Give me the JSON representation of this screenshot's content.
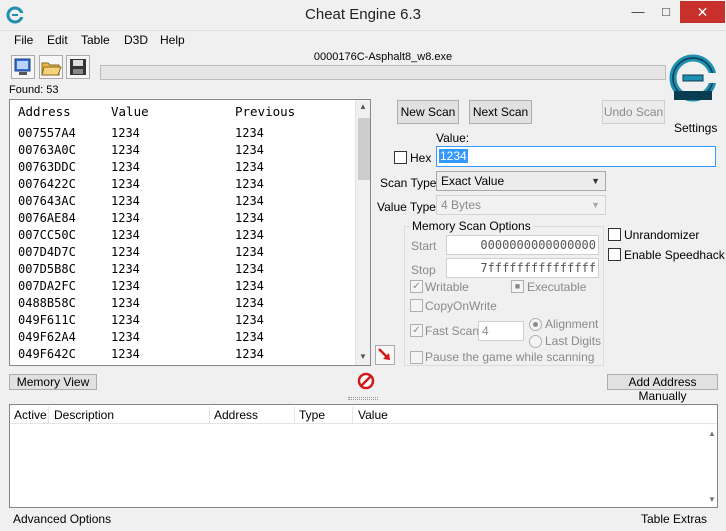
{
  "window": {
    "title": "Cheat Engine 6.3"
  },
  "menu": [
    "File",
    "Edit",
    "Table",
    "D3D",
    "Help"
  ],
  "process": {
    "name": "0000176C-Asphalt8_w8.exe",
    "progress": 0
  },
  "found_label": "Found: 53",
  "results": {
    "columns": [
      "Address",
      "Value",
      "Previous"
    ],
    "rows": [
      {
        "address": "007557A4",
        "value": "1234",
        "previous": "1234"
      },
      {
        "address": "00763A0C",
        "value": "1234",
        "previous": "1234"
      },
      {
        "address": "00763DDC",
        "value": "1234",
        "previous": "1234"
      },
      {
        "address": "0076422C",
        "value": "1234",
        "previous": "1234"
      },
      {
        "address": "007643AC",
        "value": "1234",
        "previous": "1234"
      },
      {
        "address": "0076AE84",
        "value": "1234",
        "previous": "1234"
      },
      {
        "address": "007CC50C",
        "value": "1234",
        "previous": "1234"
      },
      {
        "address": "007D4D7C",
        "value": "1234",
        "previous": "1234"
      },
      {
        "address": "007D5B8C",
        "value": "1234",
        "previous": "1234"
      },
      {
        "address": "007DA2FC",
        "value": "1234",
        "previous": "1234"
      },
      {
        "address": "0488B58C",
        "value": "1234",
        "previous": "1234"
      },
      {
        "address": "049F611C",
        "value": "1234",
        "previous": "1234"
      },
      {
        "address": "049F62A4",
        "value": "1234",
        "previous": "1234"
      },
      {
        "address": "049F642C",
        "value": "1234",
        "previous": "1234"
      }
    ]
  },
  "scan": {
    "new_scan": "New Scan",
    "next_scan": "Next Scan",
    "undo_scan": "Undo Scan",
    "settings": "Settings",
    "value_label": "Value:",
    "hex_label": "Hex",
    "value": "1234",
    "scan_type_label": "Scan Type",
    "scan_type": "Exact Value",
    "value_type_label": "Value Type",
    "value_type": "4 Bytes"
  },
  "memory_scan": {
    "title": "Memory Scan Options",
    "start_label": "Start",
    "start_value": "0000000000000000",
    "stop_label": "Stop",
    "stop_value": "7fffffffffffffff",
    "writable": "Writable",
    "executable": "Executable",
    "copy_on_write": "CopyOnWrite",
    "fast_scan": "Fast Scan",
    "fast_scan_value": "4",
    "alignment": "Alignment",
    "last_digits": "Last Digits",
    "pause_game": "Pause the game while scanning"
  },
  "options": {
    "unrandomizer": "Unrandomizer",
    "enable_speedhack": "Enable Speedhack"
  },
  "buttons": {
    "memory_view": "Memory View",
    "add_address_manually": "Add Address Manually"
  },
  "address_list": {
    "columns": [
      "Active",
      "Description",
      "Address",
      "Type",
      "Value"
    ]
  },
  "footer": {
    "advanced_options": "Advanced Options",
    "table_extras": "Table Extras"
  },
  "colors": {
    "close_button": "#c7302b",
    "selected_text_bg": "#3399ff",
    "logo_teal": "#1e8fb0"
  },
  "icons": [
    "app-logo-icon",
    "open-process-icon",
    "open-file-icon",
    "save-icon",
    "cheat-engine-logo-icon",
    "add-to-list-arrow-icon",
    "clear-icon"
  ]
}
